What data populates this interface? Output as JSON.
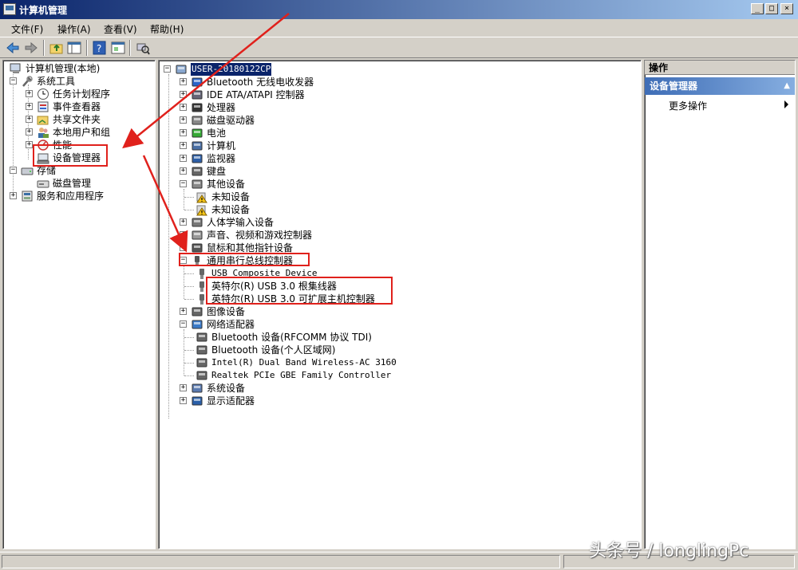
{
  "window": {
    "title": "计算机管理"
  },
  "menu": [
    "文件(F)",
    "操作(A)",
    "查看(V)",
    "帮助(H)"
  ],
  "window_buttons": {
    "minimize": "_",
    "maximize": "□",
    "close": "×"
  },
  "toolbar": {
    "icons": [
      "back-icon",
      "forward-icon",
      "up-folder-icon",
      "show-hide-tree-icon",
      "help-icon",
      "properties-icon",
      "scan-hardware-icon"
    ]
  },
  "left_tree": {
    "root": "计算机管理(本地)",
    "system_tools": "系统工具",
    "task_scheduler": "任务计划程序",
    "event_viewer": "事件查看器",
    "shared_folders": "共享文件夹",
    "local_users": "本地用户和组",
    "performance": "性能",
    "device_manager": "设备管理器",
    "storage": "存储",
    "disk_management": "磁盘管理",
    "services_apps": "服务和应用程序"
  },
  "device_tree": {
    "computer": "USER-20180122CP",
    "categories": [
      "Bluetooth 无线电收发器",
      "IDE ATA/ATAPI 控制器",
      "处理器",
      "磁盘驱动器",
      "电池",
      "计算机",
      "监视器",
      "键盘",
      "其他设备",
      "人体学输入设备",
      "声音、视频和游戏控制器",
      "鼠标和其他指针设备",
      "通用串行总线控制器",
      "图像设备",
      "网络适配器",
      "系统设备",
      "显示适配器"
    ],
    "other_devices": [
      "未知设备",
      "未知设备"
    ],
    "usb_devices": [
      "USB Composite Device",
      "英特尔(R) USB 3.0 根集线器",
      "英特尔(R) USB 3.0 可扩展主机控制器"
    ],
    "network_adapters": [
      "Bluetooth 设备(RFCOMM 协议 TDI)",
      "Bluetooth 设备(个人区域网)",
      "Intel(R) Dual Band Wireless-AC 3160",
      "Realtek PCIe GBE Family Controller"
    ]
  },
  "actions": {
    "header": "操作",
    "section": "设备管理器",
    "more": "更多操作"
  },
  "watermark": "头条号 / longlingPc",
  "colors": {
    "highlight_red": "#e0211c",
    "selection": "#0a246a"
  }
}
